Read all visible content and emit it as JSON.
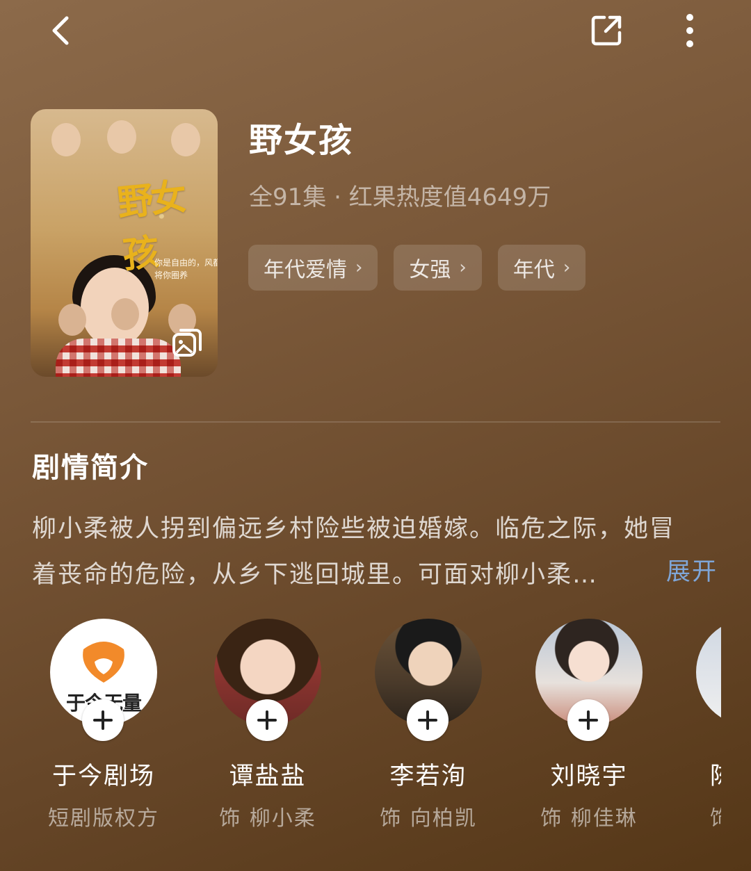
{
  "topbar": {
    "back_icon": "chevron-left-icon",
    "share_icon": "share-icon",
    "more_icon": "more-vertical-icon"
  },
  "poster": {
    "title_art": "野女孩",
    "tagline": "你是自由的，风都无法将你圈养"
  },
  "drama": {
    "title": "野女孩",
    "meta": "全91集 · 红果热度值4649万",
    "tags": [
      {
        "label": "年代爱情"
      },
      {
        "label": "女强"
      },
      {
        "label": "年代"
      }
    ]
  },
  "synopsis": {
    "heading": "剧情简介",
    "line1": "柳小柔被人拐到偏远乡村险些被迫婚嫁。临危之际，她冒",
    "line2": "着丧命的危险，从乡下逃回城里。可面对柳小柔…",
    "expand_label": "展开",
    "expand_color": "#7fa6d8"
  },
  "cast": [
    {
      "name": "于今剧场",
      "role": "短剧版权方",
      "logo_text": "于今无量"
    },
    {
      "name": "谭盐盐",
      "role": "饰 柳小柔"
    },
    {
      "name": "李若洵",
      "role": "饰 向柏凯"
    },
    {
      "name": "刘晓宇",
      "role": "饰 柳佳琳"
    },
    {
      "name": "陈",
      "role": "饰"
    }
  ],
  "colors": {
    "background_top": "#8c6a4a",
    "background_bottom": "#553717",
    "logo_orange": "#f28a2a"
  }
}
